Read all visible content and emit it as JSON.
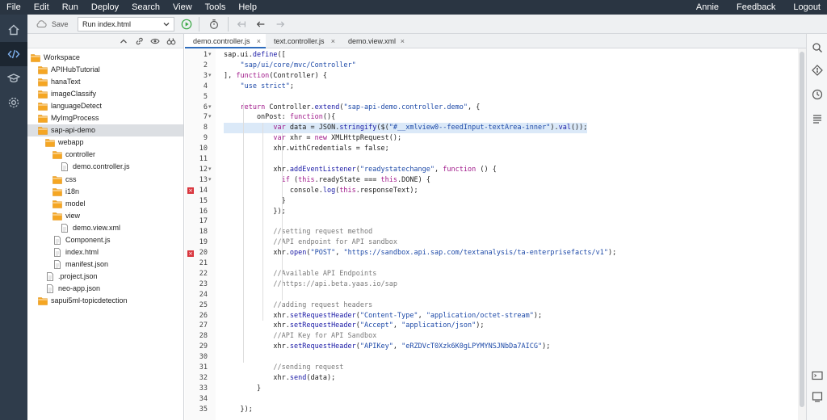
{
  "menu": {
    "items": [
      "File",
      "Edit",
      "Run",
      "Deploy",
      "Search",
      "View",
      "Tools",
      "Help"
    ],
    "user": "Annie",
    "feedback": "Feedback",
    "logout": "Logout"
  },
  "rail": {
    "icons": [
      "home-icon",
      "code-icon",
      "learning-icon",
      "settings-icon"
    ],
    "active": "code-icon"
  },
  "toolbar": {
    "save_label": "Save",
    "run_select": "Run index.html"
  },
  "tree": {
    "items": [
      {
        "label": "Workspace",
        "type": "folder",
        "depth": 0,
        "selected": false
      },
      {
        "label": "APIHubTutorial",
        "type": "folder",
        "depth": 1,
        "selected": false
      },
      {
        "label": "hanaText",
        "type": "folder",
        "depth": 1,
        "selected": false
      },
      {
        "label": "imageClassify",
        "type": "folder",
        "depth": 1,
        "selected": false
      },
      {
        "label": "languageDetect",
        "type": "folder",
        "depth": 1,
        "selected": false
      },
      {
        "label": "MyImgProcess",
        "type": "folder",
        "depth": 1,
        "selected": false
      },
      {
        "label": "sap-api-demo",
        "type": "folder",
        "depth": 1,
        "selected": true
      },
      {
        "label": "webapp",
        "type": "folder",
        "depth": 2,
        "selected": false
      },
      {
        "label": "controller",
        "type": "folder",
        "depth": 3,
        "selected": false
      },
      {
        "label": "demo.controller.js",
        "type": "file",
        "depth": 4,
        "selected": false
      },
      {
        "label": "css",
        "type": "folder",
        "depth": 3,
        "selected": false
      },
      {
        "label": "i18n",
        "type": "folder",
        "depth": 3,
        "selected": false
      },
      {
        "label": "model",
        "type": "folder",
        "depth": 3,
        "selected": false
      },
      {
        "label": "view",
        "type": "folder",
        "depth": 3,
        "selected": false
      },
      {
        "label": "demo.view.xml",
        "type": "file",
        "depth": 4,
        "selected": false
      },
      {
        "label": "Component.js",
        "type": "file",
        "depth": 3,
        "selected": false
      },
      {
        "label": "index.html",
        "type": "file",
        "depth": 3,
        "selected": false
      },
      {
        "label": "manifest.json",
        "type": "file",
        "depth": 3,
        "selected": false
      },
      {
        "label": ".project.json",
        "type": "file",
        "depth": 2,
        "selected": false
      },
      {
        "label": "neo-app.json",
        "type": "file",
        "depth": 2,
        "selected": false
      },
      {
        "label": "sapui5ml-topicdetection",
        "type": "folder",
        "depth": 1,
        "selected": false
      }
    ]
  },
  "tabs": [
    {
      "label": "demo.controller.js",
      "active": true
    },
    {
      "label": "text.controller.js",
      "active": false
    },
    {
      "label": "demo.view.xml",
      "active": false
    }
  ],
  "editor": {
    "lines": [
      {
        "n": "1",
        "fold": true,
        "err": false,
        "hl": false,
        "t": "sap.ui.define(["
      },
      {
        "n": "2",
        "fold": false,
        "err": false,
        "hl": false,
        "t": "    \"sap/ui/core/mvc/Controller\""
      },
      {
        "n": "3",
        "fold": true,
        "err": false,
        "hl": false,
        "t": "], function(Controller) {"
      },
      {
        "n": "4",
        "fold": false,
        "err": false,
        "hl": false,
        "t": "    \"use strict\";"
      },
      {
        "n": "5",
        "fold": false,
        "err": false,
        "hl": false,
        "t": ""
      },
      {
        "n": "6",
        "fold": true,
        "err": false,
        "hl": false,
        "t": "    return Controller.extend(\"sap-api-demo.controller.demo\", {"
      },
      {
        "n": "7",
        "fold": true,
        "err": false,
        "hl": false,
        "t": "        onPost: function(){"
      },
      {
        "n": "8",
        "fold": false,
        "err": false,
        "hl": true,
        "t": "            var data = JSON.stringify($(\"#__xmlview0--feedInput-textArea-inner\").val());"
      },
      {
        "n": "9",
        "fold": false,
        "err": false,
        "hl": false,
        "t": "            var xhr = new XMLHttpRequest();"
      },
      {
        "n": "10",
        "fold": false,
        "err": false,
        "hl": false,
        "t": "            xhr.withCredentials = false;"
      },
      {
        "n": "11",
        "fold": false,
        "err": false,
        "hl": false,
        "t": ""
      },
      {
        "n": "12",
        "fold": true,
        "err": false,
        "hl": false,
        "t": "            xhr.addEventListener(\"readystatechange\", function () {"
      },
      {
        "n": "13",
        "fold": true,
        "err": false,
        "hl": false,
        "t": "              if (this.readyState === this.DONE) {"
      },
      {
        "n": "14",
        "fold": false,
        "err": true,
        "hl": false,
        "t": "                console.log(this.responseText);"
      },
      {
        "n": "15",
        "fold": false,
        "err": false,
        "hl": false,
        "t": "              }"
      },
      {
        "n": "16",
        "fold": false,
        "err": false,
        "hl": false,
        "t": "            });"
      },
      {
        "n": "17",
        "fold": false,
        "err": false,
        "hl": false,
        "t": ""
      },
      {
        "n": "18",
        "fold": false,
        "err": false,
        "hl": false,
        "t": "            //setting request method"
      },
      {
        "n": "19",
        "fold": false,
        "err": false,
        "hl": false,
        "t": "            //API endpoint for API sandbox"
      },
      {
        "n": "20",
        "fold": false,
        "err": true,
        "hl": false,
        "t": "            xhr.open(\"POST\", \"https://sandbox.api.sap.com/textanalysis/ta-enterprisefacts/v1\");"
      },
      {
        "n": "21",
        "fold": false,
        "err": false,
        "hl": false,
        "t": ""
      },
      {
        "n": "22",
        "fold": false,
        "err": false,
        "hl": false,
        "t": "            //Available API Endpoints"
      },
      {
        "n": "23",
        "fold": false,
        "err": false,
        "hl": false,
        "t": "            //https://api.beta.yaas.io/sap"
      },
      {
        "n": "24",
        "fold": false,
        "err": false,
        "hl": false,
        "t": ""
      },
      {
        "n": "25",
        "fold": false,
        "err": false,
        "hl": false,
        "t": "            //adding request headers"
      },
      {
        "n": "26",
        "fold": false,
        "err": false,
        "hl": false,
        "t": "            xhr.setRequestHeader(\"Content-Type\", \"application/octet-stream\");"
      },
      {
        "n": "27",
        "fold": false,
        "err": false,
        "hl": false,
        "t": "            xhr.setRequestHeader(\"Accept\", \"application/json\");"
      },
      {
        "n": "28",
        "fold": false,
        "err": false,
        "hl": false,
        "t": "            //API Key for API Sandbox"
      },
      {
        "n": "29",
        "fold": false,
        "err": false,
        "hl": false,
        "t": "            xhr.setRequestHeader(\"APIKey\", \"eRZDVcT0Xzk6K0gLPYMYNSJNbDa7AICG\");"
      },
      {
        "n": "30",
        "fold": false,
        "err": false,
        "hl": false,
        "t": ""
      },
      {
        "n": "31",
        "fold": false,
        "err": false,
        "hl": false,
        "t": "            //sending request"
      },
      {
        "n": "32",
        "fold": false,
        "err": false,
        "hl": false,
        "t": "            xhr.send(data);"
      },
      {
        "n": "33",
        "fold": false,
        "err": false,
        "hl": false,
        "t": "        }"
      },
      {
        "n": "34",
        "fold": false,
        "err": false,
        "hl": false,
        "t": ""
      },
      {
        "n": "35",
        "fold": false,
        "err": false,
        "hl": false,
        "t": "    });"
      }
    ]
  },
  "right_rail": {
    "icons": [
      "search-icon",
      "git-icon",
      "history-icon",
      "outline-icon",
      "console-icon",
      "problems-icon"
    ]
  }
}
